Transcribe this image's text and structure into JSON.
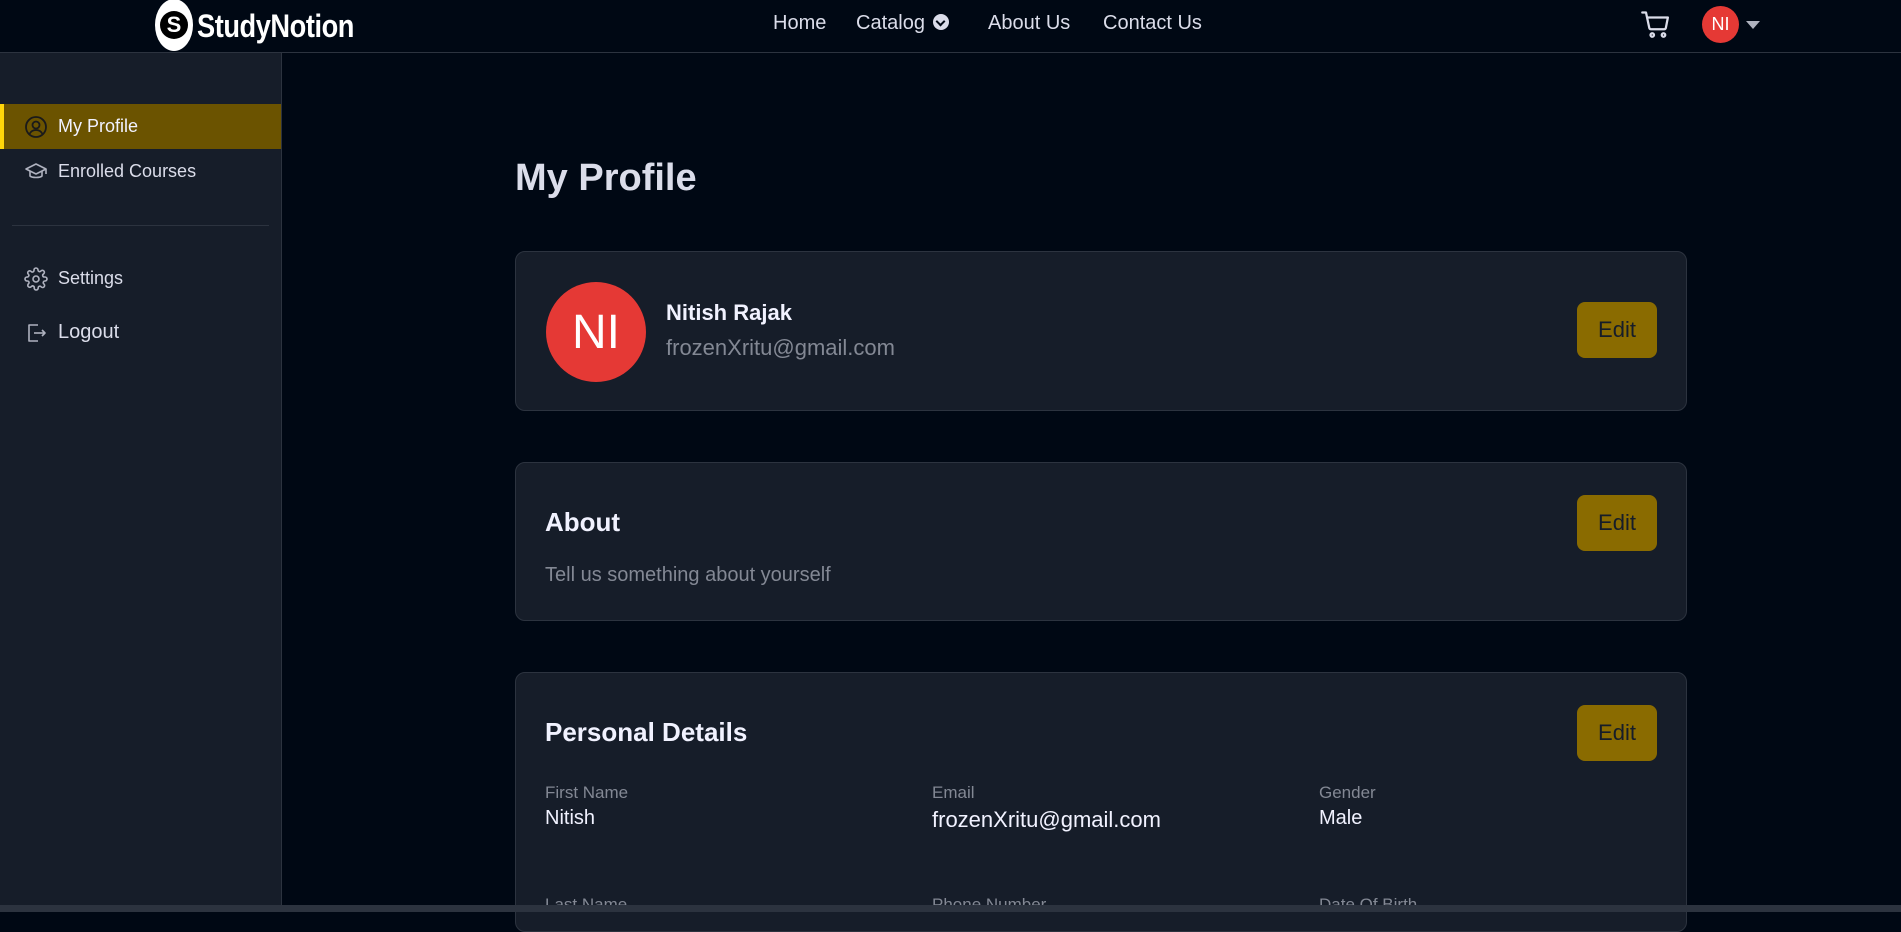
{
  "brand": {
    "name": "StudyNotion",
    "mark": "S"
  },
  "nav": {
    "items": [
      {
        "label": "Home"
      },
      {
        "label": "Catalog"
      },
      {
        "label": "About Us"
      },
      {
        "label": "Contact Us"
      }
    ],
    "cart_icon": "cart-icon",
    "avatar_initials": "NI"
  },
  "sidebar": {
    "items": [
      {
        "label": "My Profile",
        "icon": "user-circle-icon",
        "active": true
      },
      {
        "label": "Enrolled Courses",
        "icon": "graduation-cap-icon",
        "active": false
      },
      {
        "label": "Settings",
        "icon": "gear-icon",
        "active": false
      },
      {
        "label": "Logout",
        "icon": "logout-icon",
        "active": false
      }
    ]
  },
  "page": {
    "title": "My Profile"
  },
  "profile": {
    "initials": "NI",
    "name": "Nitish Rajak",
    "email": "frozenXritu@gmail.com",
    "edit_label": "Edit"
  },
  "about": {
    "title": "About",
    "text": "Tell us something about yourself",
    "edit_label": "Edit"
  },
  "personal": {
    "title": "Personal Details",
    "edit_label": "Edit",
    "fields": [
      {
        "label": "First Name",
        "value": "Nitish"
      },
      {
        "label": "Email",
        "value": "frozenXritu@gmail.com"
      },
      {
        "label": "Gender",
        "value": "Male"
      },
      {
        "label": "Last Name",
        "value": ""
      },
      {
        "label": "Phone Number",
        "value": ""
      },
      {
        "label": "Date Of Birth",
        "value": ""
      }
    ]
  },
  "colors": {
    "bg": "#000814",
    "panel": "#161D29",
    "accent": "#FFD60A",
    "avatar": "#E53935"
  }
}
